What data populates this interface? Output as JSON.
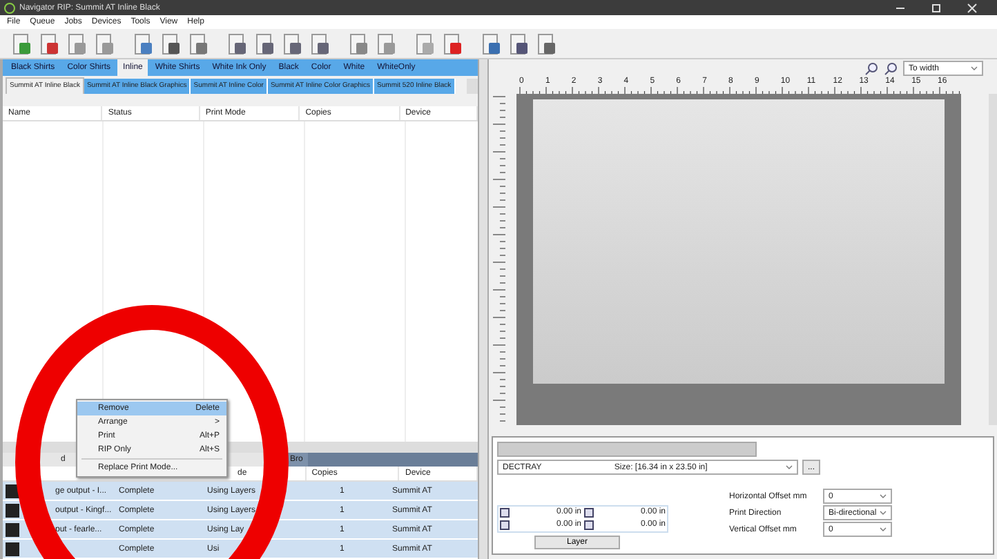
{
  "window": {
    "title": "Navigator RIP: Summit AT Inline Black"
  },
  "menu": [
    "File",
    "Queue",
    "Jobs",
    "Devices",
    "Tools",
    "View",
    "Help"
  ],
  "queue_groups": [
    {
      "label": "Black Shirts",
      "selected": false
    },
    {
      "label": "Color Shirts",
      "selected": false
    },
    {
      "label": "Inline",
      "selected": true
    },
    {
      "label": "White Shirts",
      "selected": false
    },
    {
      "label": "White Ink Only",
      "selected": false
    },
    {
      "label": "Black",
      "selected": false
    },
    {
      "label": "Color",
      "selected": false
    },
    {
      "label": "White",
      "selected": false
    },
    {
      "label": "WhiteOnly",
      "selected": false
    }
  ],
  "queues": [
    {
      "label": "Summit AT Inline Black",
      "selected": true
    },
    {
      "label": "Summit AT Inline Black Graphics",
      "selected": false
    },
    {
      "label": "Summit AT Inline Color",
      "selected": false
    },
    {
      "label": "Summit AT Inline Color Graphics",
      "selected": false
    },
    {
      "label": "Summit 520 Inline Black",
      "selected": false
    }
  ],
  "job_table": {
    "columns": [
      "Name",
      "Status",
      "Print Mode",
      "Copies",
      "Device"
    ]
  },
  "context_menu": [
    {
      "label": "Remove",
      "shortcut": "Delete",
      "selected": true,
      "kind": "item"
    },
    {
      "label": "Arrange",
      "shortcut": ">",
      "selected": false,
      "kind": "item"
    },
    {
      "label": "Print",
      "shortcut": "Alt+P",
      "selected": false,
      "kind": "item"
    },
    {
      "label": "RIP Only",
      "shortcut": "Alt+S",
      "selected": false,
      "kind": "item"
    },
    {
      "label": "Replace Print Mode...",
      "selected": false,
      "kind": "separated"
    }
  ],
  "lower_tabs": [
    {
      "label": "d",
      "selected": true
    },
    {
      "label": "Bro",
      "selected": false
    }
  ],
  "printed_table": {
    "columns": [
      "de",
      "Copies",
      "Device"
    ],
    "rows": [
      {
        "name": "ge output - I...",
        "status": "Complete",
        "print_mode": "Using Layers",
        "copies": "1",
        "device": "Summit AT"
      },
      {
        "name": "output - Kingf...",
        "status": "Complete",
        "print_mode": "Using Layers",
        "copies": "1",
        "device": "Summit AT"
      },
      {
        "name": "put - fearle...",
        "status": "Complete",
        "print_mode": "Using Lay",
        "copies": "1",
        "device": "Summit AT"
      },
      {
        "status": "Complete",
        "print_mode": "Usi",
        "copies": "1",
        "device": "Summit AT"
      }
    ]
  },
  "preview": {
    "zoom": "To width",
    "ruler": [
      "0",
      "1",
      "2",
      "3",
      "4",
      "5",
      "6",
      "7",
      "8",
      "9",
      "10",
      "11",
      "12",
      "13",
      "14",
      "15",
      "16"
    ]
  },
  "settings": {
    "media": "DECTRAY",
    "size": "Size: [16.34 in x 23.50 in]",
    "more_button": "...",
    "margins": [
      "0.00 in",
      "0.00 in",
      "0.00 in",
      "0.00 in"
    ],
    "layer_button": "Layer",
    "fields": [
      {
        "label": "Horizontal Offset mm",
        "value": "0"
      },
      {
        "label": "Print Direction",
        "value": "Bi-directional"
      },
      {
        "label": "Vertical Offset mm",
        "value": "0"
      }
    ]
  }
}
